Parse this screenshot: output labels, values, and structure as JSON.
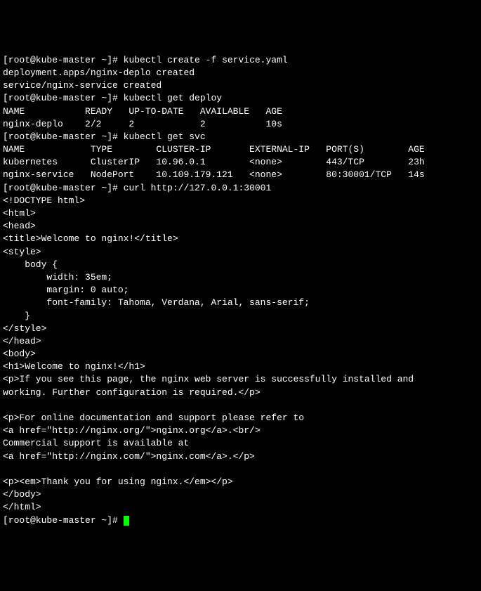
{
  "prompt": "[root@kube-master ~]# ",
  "cmd1": "kubectl create -f service.yaml",
  "out1_l1": "deployment.apps/nginx-deplo created",
  "out1_l2": "service/nginx-service created",
  "cmd2": "kubectl get deploy",
  "deploy_header": "NAME           READY   UP-TO-DATE   AVAILABLE   AGE",
  "deploy_row": "nginx-deplo    2/2     2            2           10s",
  "cmd3": "kubectl get svc",
  "svc_header": "NAME            TYPE        CLUSTER-IP       EXTERNAL-IP   PORT(S)        AGE",
  "svc_row1": "kubernetes      ClusterIP   10.96.0.1        <none>        443/TCP        23h",
  "svc_row2": "nginx-service   NodePort    10.109.179.121   <none>        80:30001/TCP   14s",
  "cmd4": "curl http://127.0.0.1:30001",
  "h01": "<!DOCTYPE html>",
  "h02": "<html>",
  "h03": "<head>",
  "h04": "<title>Welcome to nginx!</title>",
  "h05": "<style>",
  "h06": "    body {",
  "h07": "        width: 35em;",
  "h08": "        margin: 0 auto;",
  "h09": "        font-family: Tahoma, Verdana, Arial, sans-serif;",
  "h10": "    }",
  "h11": "</style>",
  "h12": "</head>",
  "h13": "<body>",
  "h14": "<h1>Welcome to nginx!</h1>",
  "h15": "<p>If you see this page, the nginx web server is successfully installed and",
  "h16": "working. Further configuration is required.</p>",
  "h17": "",
  "h18": "<p>For online documentation and support please refer to",
  "h19": "<a href=\"http://nginx.org/\">nginx.org</a>.<br/>",
  "h20": "Commercial support is available at",
  "h21": "<a href=\"http://nginx.com/\">nginx.com</a>.</p>",
  "h22": "",
  "h23": "<p><em>Thank you for using nginx.</em></p>",
  "h24": "</body>",
  "h25": "</html>"
}
